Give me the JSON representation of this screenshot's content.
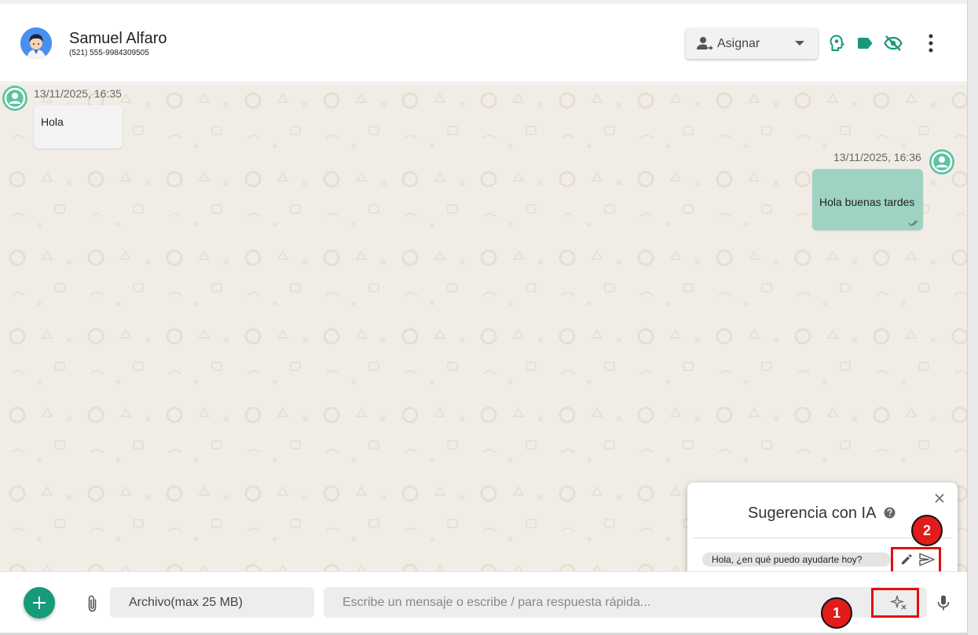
{
  "header": {
    "contact_name": "Samuel Alfaro",
    "contact_phone": "(521) 555-9984309505",
    "assign_label": "Asignar",
    "icons": [
      "account-arrow-icon",
      "head-idea-icon",
      "tag-icon",
      "eye-off-icon",
      "more-vert-icon"
    ],
    "accent_color": "#169a7a"
  },
  "messages": [
    {
      "direction": "incoming",
      "timestamp": "13/11/2025, 16:35",
      "text": "Hola"
    },
    {
      "direction": "outgoing",
      "timestamp": "13/11/2025, 16:36",
      "text": "Hola buenas tardes",
      "status": "read"
    }
  ],
  "ai_popup": {
    "title": "Sugerencia con IA",
    "suggestion": "Hola, ¿en qué puedo ayudarte hoy?"
  },
  "annotations": [
    {
      "label": "1"
    },
    {
      "label": "2"
    }
  ],
  "composer": {
    "file_label": "Archivo(max 25 MB)",
    "placeholder": "Escribe un mensaje o escribe / para respuesta rápida..."
  },
  "colors": {
    "outgoing_bubble": "#9fd3c1",
    "incoming_bubble": "#f3f3f3",
    "chat_background": "#f1ede6",
    "annotation": "#e21b1b"
  }
}
